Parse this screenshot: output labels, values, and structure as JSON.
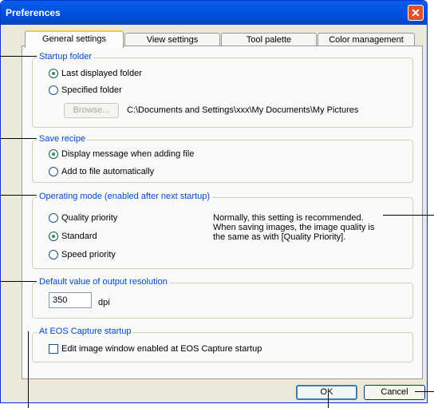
{
  "window": {
    "title": "Preferences",
    "close_glyph": "✕"
  },
  "tabs": [
    {
      "label": "General settings"
    },
    {
      "label": "View settings"
    },
    {
      "label": "Tool palette"
    },
    {
      "label": "Color management"
    }
  ],
  "startup_folder": {
    "legend": "Startup folder",
    "option_last": "Last displayed folder",
    "option_specified": "Specified folder",
    "browse_label": "Browse...",
    "path": "C:\\Documents and Settings\\xxx\\My Documents\\My Pictures",
    "selected": "last"
  },
  "save_recipe": {
    "legend": "Save recipe",
    "option_display": "Display message when adding file",
    "option_add": "Add to file automatically",
    "selected": "display"
  },
  "operating_mode": {
    "legend": "Operating mode (enabled after next startup)",
    "option_quality": "Quality priority",
    "option_standard": "Standard",
    "option_speed": "Speed priority",
    "selected": "standard",
    "description_line1": "Normally, this setting is recommended.",
    "description_line2": "When saving images, the image quality is",
    "description_line3": "the same as with [Quality Priority]."
  },
  "output_resolution": {
    "legend": "Default value of output resolution",
    "value": "350",
    "unit": "dpi"
  },
  "eos_capture": {
    "legend": "At EOS Capture startup",
    "checkbox_label": "Edit image window enabled at EOS Capture startup",
    "checked": false
  },
  "buttons": {
    "ok": "OK",
    "cancel": "Cancel"
  },
  "colors": {
    "title_bar": "#0054e3",
    "legend": "#0046d5",
    "dialog_bg": "#ece9d8",
    "radio_selected": "#21a121"
  }
}
